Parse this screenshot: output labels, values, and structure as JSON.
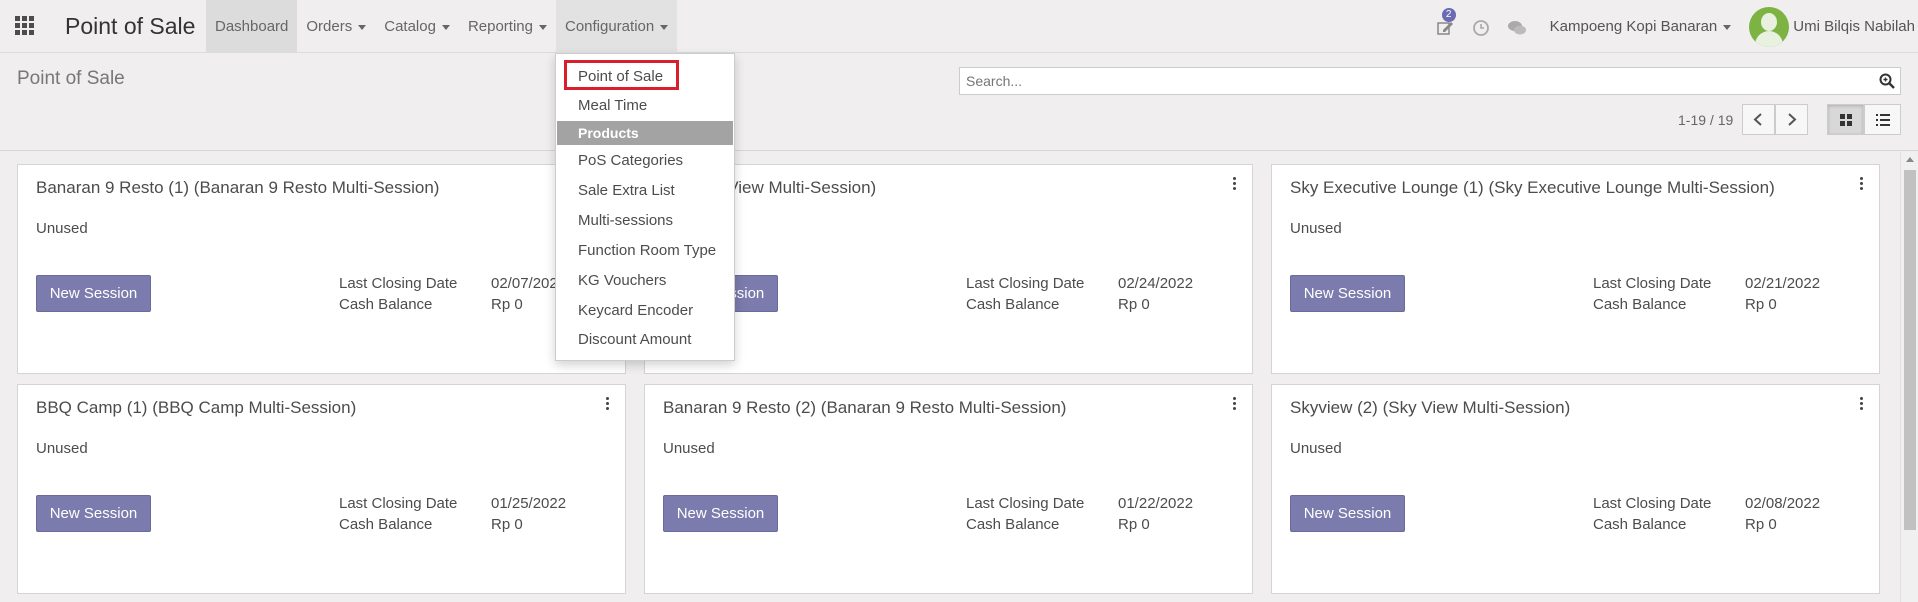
{
  "navbar": {
    "brand": "Point of Sale",
    "menu": [
      {
        "label": "Dashboard"
      },
      {
        "label": "Orders"
      },
      {
        "label": "Catalog"
      },
      {
        "label": "Reporting"
      },
      {
        "label": "Configuration"
      }
    ],
    "activity_badge": "2",
    "company": "Kampoeng Kopi Banaran",
    "user": "Umi Bilqis Nabilah",
    "icons": [
      "apps-grid-icon",
      "activity-edit-icon",
      "clock-icon",
      "chat-icon",
      "user-avatar"
    ]
  },
  "control": {
    "title": "Point of Sale",
    "search_placeholder": "Search...",
    "pager": "1-19 / 19"
  },
  "dropdown": {
    "items": [
      {
        "label": "Point of Sale",
        "highlighted": true
      },
      {
        "label": "Meal Time"
      },
      {
        "label": "Products",
        "section_header": true
      },
      {
        "label": "PoS Categories"
      },
      {
        "label": "Sale Extra List"
      },
      {
        "label": "Multi-sessions"
      },
      {
        "label": "Function Room Type"
      },
      {
        "label": "KG Vouchers"
      },
      {
        "label": "Keycard Encoder"
      },
      {
        "label": "Discount Amount"
      }
    ]
  },
  "labels": {
    "new_session": "New Session",
    "last_closing": "Last Closing Date",
    "cash_balance": "Cash Balance"
  },
  "cards": [
    {
      "title": "Banaran 9 Resto (1) (Banaran 9 Resto Multi-Session)",
      "status": "Unused",
      "last_closing": "02/07/2022",
      "cash": "Rp 0"
    },
    {
      "title": "(1) (Sky View Multi-Session)",
      "status": "",
      "last_closing": "02/24/2022",
      "cash": "Rp 0"
    },
    {
      "title": "Sky Executive Lounge (1) (Sky Executive Lounge Multi-Session)",
      "status": "Unused",
      "last_closing": "02/21/2022",
      "cash": "Rp 0"
    },
    {
      "title": "BBQ Camp (1) (BBQ Camp Multi-Session)",
      "status": "Unused",
      "last_closing": "01/25/2022",
      "cash": "Rp 0"
    },
    {
      "title": "Banaran 9 Resto (2) (Banaran 9 Resto Multi-Session)",
      "status": "Unused",
      "last_closing": "01/22/2022",
      "cash": "Rp 0"
    },
    {
      "title": "Skyview (2) (Sky View Multi-Session)",
      "status": "Unused",
      "last_closing": "02/08/2022",
      "cash": "Rp 0"
    }
  ],
  "colors": {
    "accent": "#7c7bad",
    "highlight": "#d8202c",
    "badge": "#6a6ab5"
  }
}
